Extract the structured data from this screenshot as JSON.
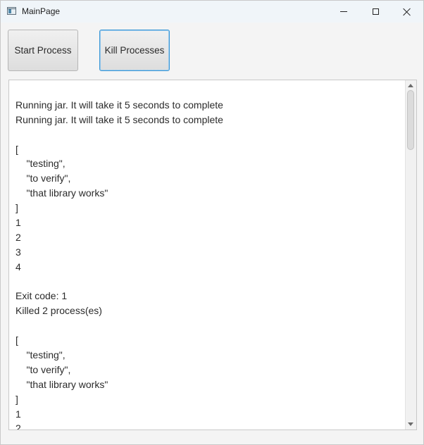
{
  "window": {
    "title": "MainPage",
    "icons": {
      "app": "app-window-icon",
      "minimize": "minimize-icon",
      "maximize": "maximize-icon",
      "close": "close-icon"
    }
  },
  "toolbar": {
    "start_label": "Start Process",
    "kill_label": "Kill Processes",
    "focused_button": "kill",
    "focus_color": "#3a97d6"
  },
  "output": {
    "lines": [
      "",
      "Running jar. It will take it 5 seconds to complete",
      "Running jar. It will take it 5 seconds to complete",
      "",
      "[",
      "    \"testing\",",
      "    \"to verify\",",
      "    \"that library works\"",
      "]",
      "1",
      "2",
      "3",
      "4",
      "",
      "Exit code: 1",
      "Killed 2 process(es)",
      "",
      "[",
      "    \"testing\",",
      "    \"to verify\",",
      "    \"that library works\"",
      "]",
      "1",
      "2"
    ]
  }
}
